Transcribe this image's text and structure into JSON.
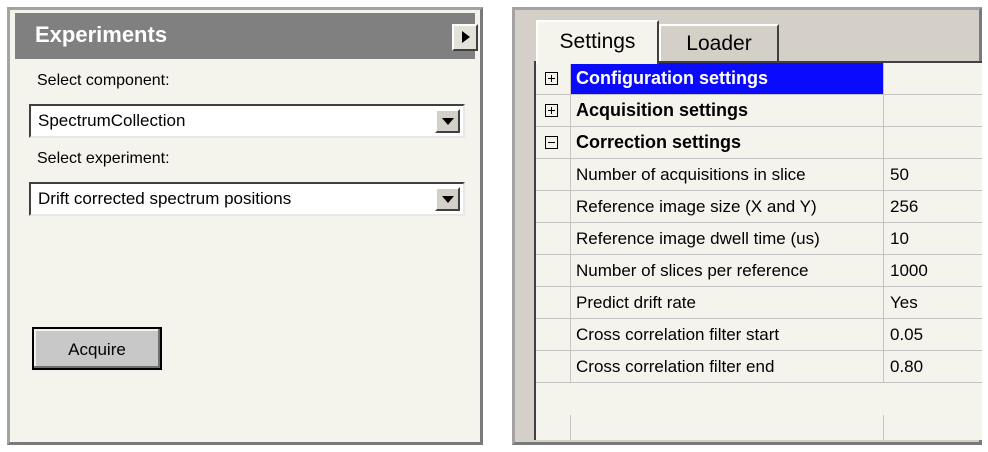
{
  "experiments_panel": {
    "title": "Experiments",
    "component_label": "Select component:",
    "component_value": "SpectrumCollection",
    "experiment_label": "Select experiment:",
    "experiment_value": "Drift corrected spectrum positions",
    "acquire_label": "Acquire"
  },
  "settings_panel": {
    "tabs": [
      "Settings",
      "Loader"
    ],
    "active_tab": "Settings",
    "categories": [
      {
        "label": "Configuration settings",
        "expanded": false,
        "selected": true
      },
      {
        "label": "Acquisition settings",
        "expanded": false,
        "selected": false
      },
      {
        "label": "Correction settings",
        "expanded": true,
        "selected": false
      }
    ],
    "properties": [
      {
        "name": "Number of acquisitions in slice",
        "value": "50"
      },
      {
        "name": "Reference image size (X and Y)",
        "value": "256"
      },
      {
        "name": "Reference image dwell time (us)",
        "value": "10"
      },
      {
        "name": "Number of slices per reference",
        "value": "1000"
      },
      {
        "name": "Predict drift rate",
        "value": "Yes"
      },
      {
        "name": "Cross correlation filter start",
        "value": "0.05"
      },
      {
        "name": "Cross correlation filter end",
        "value": "0.80"
      }
    ]
  },
  "colors": {
    "selection": "#0a0aff",
    "header": "#808080",
    "panel_background": "#f5f4ec"
  },
  "icons": {
    "collapse": "triangle-right-icon",
    "dropdown": "chevron-down-icon",
    "expand": "plus-box-icon",
    "collapse_tree": "minus-box-icon"
  }
}
